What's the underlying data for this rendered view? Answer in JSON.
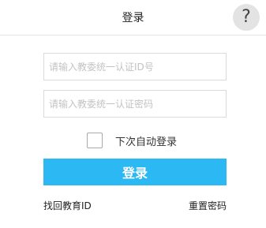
{
  "header": {
    "title": "登录",
    "help_label": "?",
    "help_icon": "question-mark-icon"
  },
  "form": {
    "id_placeholder": "请输入教委统一认证ID号",
    "id_value": "",
    "password_placeholder": "请输入教委统一认证密码",
    "password_value": "",
    "remember_label": "下次自动登录",
    "remember_checked": false,
    "login_label": "登录"
  },
  "links": {
    "find_id": "找回教育ID",
    "reset_password": "重置密码"
  },
  "colors": {
    "accent": "#2cb8f3",
    "help_bg": "#e3e3e3",
    "border": "#dadada"
  }
}
